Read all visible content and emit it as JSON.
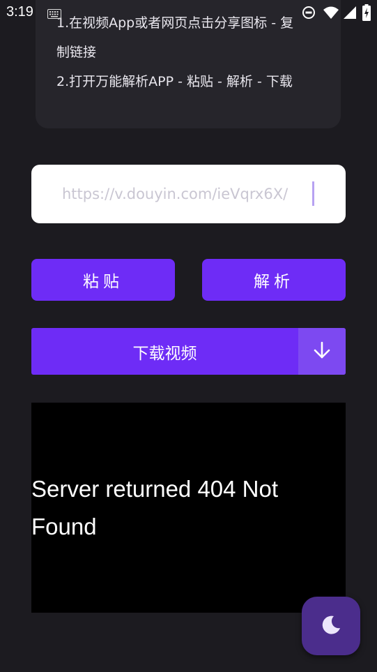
{
  "status_bar": {
    "time": "3:19",
    "icons": [
      "keyboard-icon",
      "do-not-disturb-icon",
      "wifi-icon",
      "signal-icon",
      "battery-charging-icon"
    ]
  },
  "instructions": {
    "line1a": "1.在视频App或者网页点击分享图标 - 复",
    "line1b": "制链接",
    "line2": "2.打开万能解析APP - 粘贴 - 解析 - 下载"
  },
  "url_input": {
    "value": "https://v.douyin.com/ieVqrx6X/"
  },
  "buttons": {
    "paste": "粘贴",
    "parse": "解析",
    "download": "下载视频"
  },
  "video": {
    "error_message": "Server returned 404 Not Found"
  },
  "fab": {
    "icon": "moon-icon"
  },
  "colors": {
    "background": "#1c1b20",
    "card": "#26252b",
    "accent": "#6e2cf6",
    "fab": "#4b2d8c"
  }
}
